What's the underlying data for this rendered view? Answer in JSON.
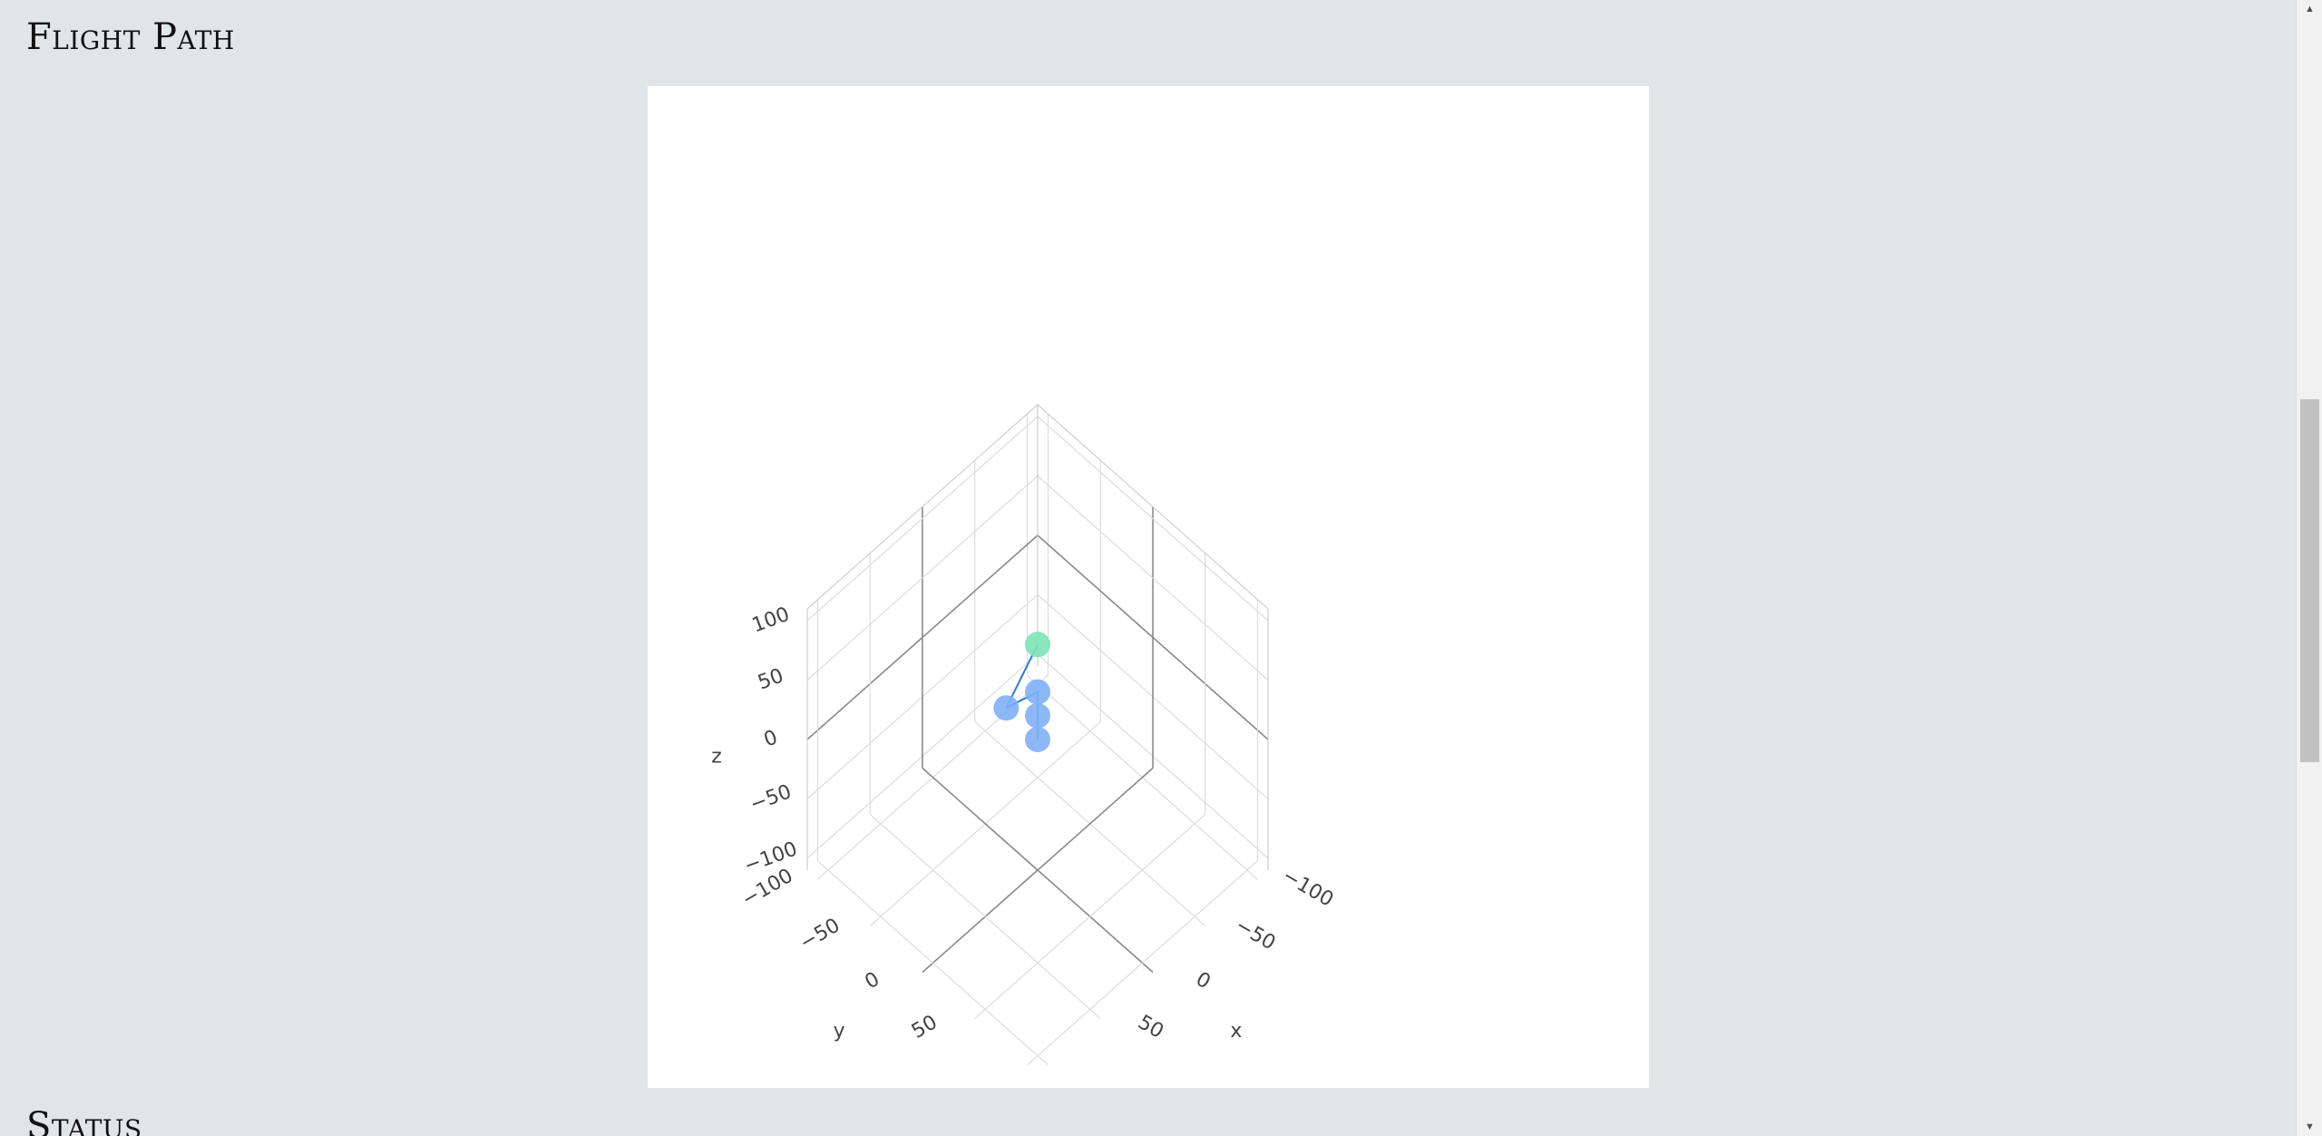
{
  "sections": {
    "flight_path_title": "Flight Path",
    "status_title": "Status"
  },
  "scrollbar": {
    "up_glyph": "▲",
    "down_glyph": "▼"
  },
  "chart_data": {
    "type": "scatter3d",
    "title": "",
    "axes": {
      "x": {
        "label": "x",
        "ticks": [
          "−100",
          "−50",
          "0",
          "50"
        ]
      },
      "y": {
        "label": "y",
        "ticks": [
          "−100",
          "−50",
          "0",
          "50"
        ]
      },
      "z": {
        "label": "z",
        "ticks": [
          "−100",
          "−50",
          "0",
          "50",
          "100"
        ]
      }
    },
    "grid": true,
    "colors": {
      "start_marker": "#7de3b6",
      "marker": "#7fb0f7",
      "line": "#2f7bd6"
    },
    "series": [
      {
        "points": [
          {
            "x": 0,
            "y": 0,
            "z": 0
          },
          {
            "x": 0,
            "y": 0,
            "z": 20
          },
          {
            "x": 0,
            "y": 0,
            "z": 40
          },
          {
            "x": 30,
            "y": 0,
            "z": 50
          },
          {
            "x": 0,
            "y": 0,
            "z": 80
          }
        ]
      }
    ]
  }
}
